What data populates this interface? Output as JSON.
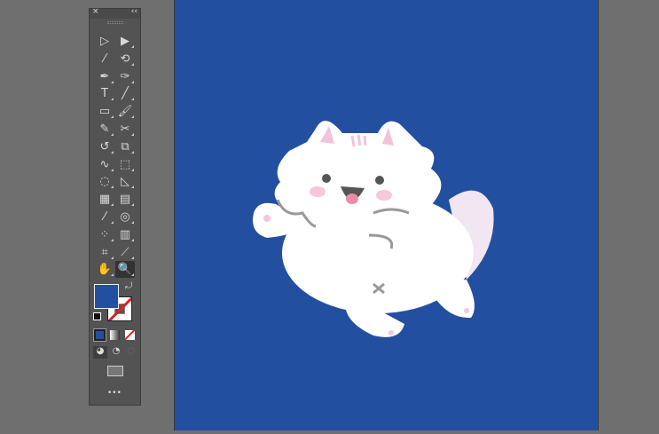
{
  "toolbar": {
    "close_icon": "×",
    "collapse_icon": "‹‹",
    "more_label": "•••",
    "tools": [
      {
        "name": "selection-tool",
        "glyph": "▷"
      },
      {
        "name": "direct-selection-tool",
        "glyph": "▶"
      },
      {
        "name": "magic-wand-tool",
        "glyph": "⁄"
      },
      {
        "name": "lasso-tool",
        "glyph": "⟲"
      },
      {
        "name": "pen-tool",
        "glyph": "✒"
      },
      {
        "name": "curvature-tool",
        "glyph": "✑"
      },
      {
        "name": "type-tool",
        "glyph": "T"
      },
      {
        "name": "line-segment-tool",
        "glyph": "╱"
      },
      {
        "name": "rectangle-tool",
        "glyph": "▭"
      },
      {
        "name": "paintbrush-tool",
        "glyph": "🖌"
      },
      {
        "name": "pencil-tool",
        "glyph": "✎"
      },
      {
        "name": "scissors-tool",
        "glyph": "✂"
      },
      {
        "name": "rotate-tool",
        "glyph": "↺"
      },
      {
        "name": "scale-tool",
        "glyph": "⧉"
      },
      {
        "name": "warp-tool",
        "glyph": "∿"
      },
      {
        "name": "free-transform-tool",
        "glyph": "⬚"
      },
      {
        "name": "shape-builder-tool",
        "glyph": "◌"
      },
      {
        "name": "perspective-grid-tool",
        "glyph": "◺"
      },
      {
        "name": "mesh-tool",
        "glyph": "▦"
      },
      {
        "name": "gradient-tool",
        "glyph": "▤"
      },
      {
        "name": "eyedropper-tool",
        "glyph": "⁄"
      },
      {
        "name": "blend-tool",
        "glyph": "◎"
      },
      {
        "name": "symbol-sprayer-tool",
        "glyph": "⁘"
      },
      {
        "name": "column-graph-tool",
        "glyph": "▥"
      },
      {
        "name": "artboard-tool",
        "glyph": "⌗"
      },
      {
        "name": "slice-tool",
        "glyph": "⟋"
      },
      {
        "name": "hand-tool",
        "glyph": "✋"
      },
      {
        "name": "zoom-tool",
        "glyph": "🔍"
      }
    ],
    "fill_color": "#234fa0",
    "stroke_color": "none"
  },
  "artboard": {
    "background": "#234fa0"
  }
}
